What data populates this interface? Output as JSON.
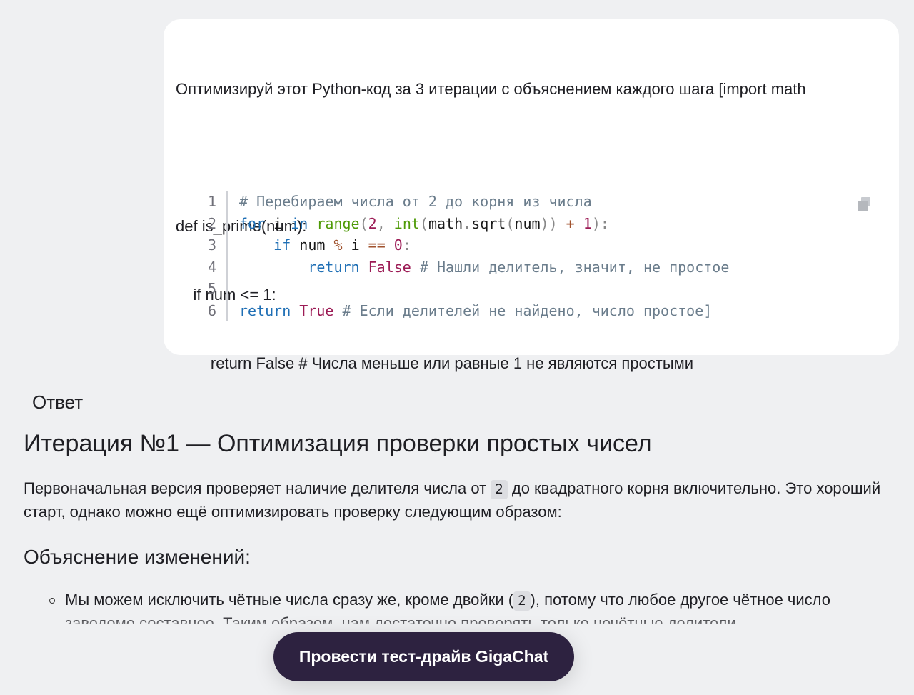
{
  "user_message": {
    "prompt_lines": [
      "Оптимизируй этот Python-код за 3 итерации с объяснением каждого шага [import math",
      "",
      "def is_prime(num):",
      "    if num <= 1:",
      "        return False # Числа меньше или равные 1 не являются простыми"
    ],
    "code_block": {
      "line_numbers": [
        "1",
        "2",
        "3",
        "4",
        "5",
        "6"
      ],
      "comment_line1": "# Перебираем числа от 2 до корня из числа",
      "line4_comment": "# Нашли делитель, значит, не простое",
      "line6_comment": "# Если делителей не найдено, число простое]"
    },
    "copy_icon": "copy-icon"
  },
  "answer": {
    "label": "Ответ",
    "iteration_title": "Итерация №1 — Оптимизация проверки простых чисел",
    "para_before": "Первоначальная версия проверяет наличие делителя числа от ",
    "para_chip": "2",
    "para_after": " до квадратного корня включительно. Это хороший старт, однако можно ещё оптимизировать проверку следующим образом:",
    "subtitle": "Объяснение изменений:",
    "bullet_before": "Мы можем исключить чётные числа сразу же, кроме двойки (",
    "bullet_chip": "2",
    "bullet_after": "), потому что любое другое чётное число заведомо составное. Таким образом, нам достаточно проверять только нечётные делители"
  },
  "cta": {
    "label": "Провести тест-драйв GigaChat"
  }
}
